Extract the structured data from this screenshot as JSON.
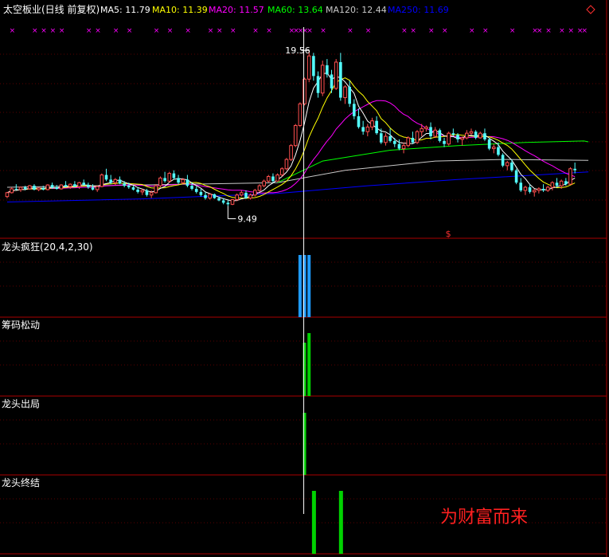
{
  "header": {
    "stock_title": "太空板业(日线 前复权)",
    "ma_labels": [
      {
        "label": "MA5: 11.79",
        "color": "#ffffff"
      },
      {
        "label": "MA10: 11.39",
        "color": "#ffff00"
      },
      {
        "label": "MA20: 11.57",
        "color": "#ff00ff"
      },
      {
        "label": "MA60: 13.64",
        "color": "#00ff00"
      },
      {
        "label": "MA120: 12.44",
        "color": "#c8c8c8"
      },
      {
        "label": "MA250: 11.69",
        "color": "#0000ff"
      }
    ],
    "diamond_icon": "diamond-icon"
  },
  "colors": {
    "background": "#000000",
    "separator": "#aa0000",
    "grid": "#5a0000",
    "candle_up": "#ff5050",
    "candle_down": "#54ffff",
    "crosshair": "#ffffff",
    "marker": "#ff00ff",
    "crazy_bar": "#1e9bff",
    "green_bar": "#00d200",
    "watermark": "#ff2020"
  },
  "annotations": {
    "high_label": "19.56",
    "low_label": "9.49",
    "dollar_marker": "$",
    "marker_glyph": "×"
  },
  "panels": [
    {
      "title": "龙头疯狂(20,4,2,30)"
    },
    {
      "title": "筹码松动"
    },
    {
      "title": "龙头出局"
    },
    {
      "title": "龙头终结"
    }
  ],
  "watermark": "为财富而来",
  "chart_data": {
    "type": "candlestick",
    "price_range": [
      9.0,
      20.5
    ],
    "candles": [
      [
        10.1,
        10.4,
        10.0,
        10.35
      ],
      [
        10.35,
        10.7,
        10.3,
        10.6
      ],
      [
        10.6,
        10.9,
        10.5,
        10.55
      ],
      [
        10.55,
        10.75,
        10.4,
        10.7
      ],
      [
        10.7,
        10.8,
        10.5,
        10.6
      ],
      [
        10.6,
        10.85,
        10.55,
        10.8
      ],
      [
        10.8,
        10.9,
        10.5,
        10.55
      ],
      [
        10.55,
        10.7,
        10.45,
        10.65
      ],
      [
        10.65,
        10.8,
        10.5,
        10.55
      ],
      [
        10.55,
        10.9,
        10.5,
        10.85
      ],
      [
        10.85,
        11.0,
        10.6,
        10.7
      ],
      [
        10.7,
        10.85,
        10.55,
        10.6
      ],
      [
        10.6,
        10.9,
        10.55,
        10.85
      ],
      [
        10.85,
        11.1,
        10.7,
        10.75
      ],
      [
        10.75,
        10.95,
        10.6,
        10.9
      ],
      [
        10.9,
        11.1,
        10.7,
        10.75
      ],
      [
        10.75,
        11.05,
        10.6,
        11.0
      ],
      [
        11.0,
        11.2,
        10.8,
        10.85
      ],
      [
        10.85,
        11.0,
        10.6,
        10.7
      ],
      [
        10.7,
        10.9,
        10.5,
        10.55
      ],
      [
        10.55,
        10.8,
        10.4,
        10.75
      ],
      [
        10.75,
        11.6,
        10.7,
        11.5
      ],
      [
        11.5,
        11.9,
        11.1,
        11.2
      ],
      [
        11.2,
        11.5,
        10.9,
        11.0
      ],
      [
        11.0,
        11.3,
        10.85,
        11.2
      ],
      [
        11.2,
        11.4,
        10.9,
        10.95
      ],
      [
        10.95,
        11.1,
        10.7,
        10.8
      ],
      [
        10.8,
        11.0,
        10.6,
        10.7
      ],
      [
        10.7,
        10.8,
        10.5,
        10.55
      ],
      [
        10.55,
        10.7,
        10.3,
        10.4
      ],
      [
        10.4,
        10.6,
        10.2,
        10.5
      ],
      [
        10.5,
        10.6,
        10.1,
        10.2
      ],
      [
        10.2,
        10.5,
        10.0,
        10.35
      ],
      [
        10.35,
        10.9,
        10.3,
        10.8
      ],
      [
        10.8,
        11.4,
        10.7,
        11.3
      ],
      [
        11.3,
        11.7,
        11.0,
        11.1
      ],
      [
        11.1,
        11.7,
        11.0,
        11.6
      ],
      [
        11.6,
        11.8,
        11.2,
        11.3
      ],
      [
        11.3,
        11.5,
        10.9,
        11.0
      ],
      [
        11.0,
        11.3,
        10.9,
        11.2
      ],
      [
        11.2,
        11.5,
        10.7,
        10.8
      ],
      [
        10.8,
        11.0,
        10.5,
        10.6
      ],
      [
        10.6,
        10.75,
        10.3,
        10.4
      ],
      [
        10.4,
        10.6,
        10.1,
        10.2
      ],
      [
        10.2,
        10.4,
        9.9,
        10.0
      ],
      [
        10.0,
        10.3,
        9.9,
        10.25
      ],
      [
        10.25,
        10.3,
        9.95,
        10.0
      ],
      [
        10.0,
        10.1,
        9.8,
        9.85
      ],
      [
        9.85,
        10.0,
        9.6,
        9.7
      ],
      [
        9.7,
        9.85,
        9.49,
        9.6
      ],
      [
        9.6,
        9.95,
        9.55,
        9.9
      ],
      [
        9.9,
        10.3,
        9.8,
        10.2
      ],
      [
        10.2,
        10.5,
        10.1,
        10.35
      ],
      [
        10.35,
        10.5,
        9.95,
        10.0
      ],
      [
        10.0,
        10.3,
        9.9,
        10.2
      ],
      [
        10.2,
        10.6,
        10.1,
        10.5
      ],
      [
        10.5,
        10.9,
        10.4,
        10.8
      ],
      [
        10.8,
        11.2,
        10.7,
        11.1
      ],
      [
        11.1,
        11.5,
        11.0,
        11.4
      ],
      [
        11.4,
        11.6,
        11.0,
        11.1
      ],
      [
        11.1,
        11.6,
        11.05,
        11.5
      ],
      [
        11.5,
        12.0,
        11.4,
        11.9
      ],
      [
        11.9,
        12.6,
        11.8,
        12.5
      ],
      [
        12.5,
        13.5,
        12.4,
        13.4
      ],
      [
        13.4,
        14.8,
        13.3,
        14.7
      ],
      [
        14.7,
        16.2,
        14.6,
        16.1
      ],
      [
        16.1,
        17.8,
        16.0,
        17.7
      ],
      [
        17.7,
        19.56,
        17.5,
        19.2
      ],
      [
        19.2,
        19.4,
        17.6,
        17.9
      ],
      [
        17.9,
        18.2,
        16.5,
        16.8
      ],
      [
        16.8,
        18.9,
        16.6,
        18.6
      ],
      [
        18.6,
        19.0,
        17.8,
        18.0
      ],
      [
        18.0,
        18.3,
        16.8,
        17.1
      ],
      [
        17.1,
        19.0,
        17.0,
        18.8
      ],
      [
        18.8,
        19.4,
        16.3,
        16.5
      ],
      [
        16.5,
        17.3,
        16.1,
        17.2
      ],
      [
        17.2,
        17.6,
        15.9,
        16.1
      ],
      [
        16.1,
        16.4,
        15.1,
        15.3
      ],
      [
        15.3,
        15.8,
        14.5,
        14.6
      ],
      [
        14.6,
        15.0,
        14.1,
        14.3
      ],
      [
        14.3,
        14.8,
        14.0,
        14.6
      ],
      [
        14.6,
        15.2,
        14.4,
        15.0
      ],
      [
        15.0,
        15.3,
        14.1,
        14.2
      ],
      [
        14.2,
        14.5,
        13.5,
        13.6
      ],
      [
        13.6,
        14.2,
        13.4,
        14.0
      ],
      [
        14.0,
        14.5,
        13.6,
        13.7
      ],
      [
        13.7,
        13.9,
        13.3,
        13.5
      ],
      [
        13.5,
        13.8,
        13.1,
        13.2
      ],
      [
        13.2,
        13.6,
        12.9,
        13.4
      ],
      [
        13.4,
        14.0,
        13.3,
        13.9
      ],
      [
        13.9,
        14.3,
        13.5,
        13.6
      ],
      [
        13.6,
        14.4,
        13.5,
        14.3
      ],
      [
        14.3,
        14.8,
        14.0,
        14.5
      ],
      [
        14.5,
        14.7,
        14.3,
        14.6
      ],
      [
        14.6,
        14.9,
        13.8,
        14.0
      ],
      [
        14.0,
        14.6,
        13.9,
        14.4
      ],
      [
        14.4,
        14.5,
        13.6,
        13.7
      ],
      [
        13.7,
        13.9,
        13.3,
        13.5
      ],
      [
        13.5,
        14.3,
        13.4,
        14.2
      ],
      [
        14.2,
        14.5,
        14.0,
        14.1
      ],
      [
        14.1,
        14.2,
        13.6,
        13.8
      ],
      [
        13.8,
        14.0,
        13.4,
        13.9
      ],
      [
        13.9,
        14.4,
        13.8,
        14.2
      ],
      [
        14.2,
        14.5,
        14.1,
        14.3
      ],
      [
        14.3,
        14.4,
        13.8,
        13.9
      ],
      [
        13.9,
        14.3,
        13.85,
        14.2
      ],
      [
        14.2,
        14.5,
        13.7,
        13.8
      ],
      [
        13.8,
        13.9,
        13.1,
        13.2
      ],
      [
        13.2,
        13.5,
        12.9,
        13.3
      ],
      [
        13.3,
        13.6,
        12.7,
        12.8
      ],
      [
        12.8,
        12.9,
        12.0,
        12.1
      ],
      [
        12.1,
        12.4,
        11.8,
        12.3
      ],
      [
        12.3,
        12.5,
        11.7,
        11.8
      ],
      [
        11.8,
        11.9,
        10.9,
        11.0
      ],
      [
        11.0,
        11.3,
        10.4,
        10.5
      ],
      [
        10.5,
        10.8,
        10.2,
        10.7
      ],
      [
        10.7,
        10.9,
        10.3,
        10.4
      ],
      [
        10.4,
        10.6,
        10.1,
        10.5
      ],
      [
        10.5,
        10.7,
        10.3,
        10.6
      ],
      [
        10.6,
        10.9,
        10.4,
        10.5
      ],
      [
        10.5,
        10.8,
        10.4,
        10.7
      ],
      [
        10.7,
        11.1,
        10.5,
        11.0
      ],
      [
        11.0,
        11.3,
        10.7,
        10.8
      ],
      [
        10.8,
        11.2,
        10.6,
        11.1
      ],
      [
        11.1,
        11.3,
        10.8,
        10.9
      ],
      [
        10.9,
        12.0,
        10.85,
        11.9
      ],
      [
        11.9,
        12.3,
        11.6,
        11.8
      ]
    ],
    "ma60_line": [
      [
        60,
        11.0
      ],
      [
        70,
        12.4
      ],
      [
        85,
        13.1
      ],
      [
        100,
        13.4
      ],
      [
        115,
        13.6
      ],
      [
        128,
        13.7
      ],
      [
        129,
        13.64
      ]
    ],
    "ma120_line": [
      [
        0,
        10.7
      ],
      [
        60,
        11.0
      ],
      [
        75,
        11.8
      ],
      [
        95,
        12.4
      ],
      [
        110,
        12.5
      ],
      [
        129,
        12.44
      ]
    ],
    "ma250_line": [
      [
        0,
        9.75
      ],
      [
        30,
        9.95
      ],
      [
        60,
        10.3
      ],
      [
        80,
        10.8
      ],
      [
        100,
        11.2
      ],
      [
        129,
        11.69
      ]
    ],
    "high_index": 67,
    "low_index": 49,
    "dollar_index": 98,
    "crosshair_index": 66,
    "marker_indices": [
      1,
      6,
      8,
      10,
      12,
      18,
      20,
      24,
      27,
      33,
      36,
      40,
      45,
      47,
      50,
      55,
      58,
      63,
      64,
      65,
      66,
      67,
      70,
      76,
      80,
      88,
      90,
      94,
      97,
      103,
      106,
      112,
      117,
      118,
      120,
      123,
      125,
      127,
      128
    ],
    "panel_signals": {
      "longtou_fengkuang": [
        65,
        66,
        67
      ],
      "chouma_songdong": [
        66,
        67
      ],
      "longtou_chuju": [
        66
      ],
      "longtou_zhongjie": [
        68,
        74
      ]
    }
  }
}
